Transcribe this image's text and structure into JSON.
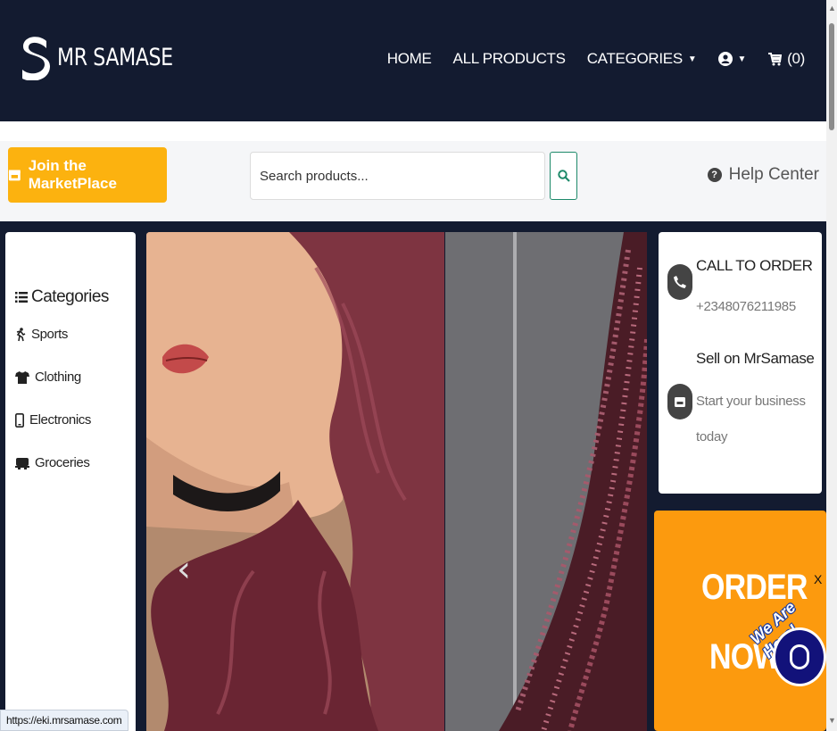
{
  "brand": {
    "name": "MR SAMASE",
    "logo_letter": "S"
  },
  "nav": {
    "home": "HOME",
    "all_products": "ALL PRODUCTS",
    "categories": "CATEGORIES",
    "cart": "(0)"
  },
  "subheader": {
    "join_label": "Join the MarketPlace",
    "search_placeholder": "Search products...",
    "help_label": "Help Center"
  },
  "categories": {
    "title": "Categories",
    "items": [
      {
        "label": "Sports",
        "icon": "running-icon"
      },
      {
        "label": "Clothing",
        "icon": "tshirt-icon"
      },
      {
        "label": "Electronics",
        "icon": "phone-icon"
      },
      {
        "label": "Groceries",
        "icon": "truck-icon"
      }
    ]
  },
  "contact": {
    "call_title": "CALL TO ORDER",
    "phone": "+2348076211985",
    "sell_title": "Sell on MrSamase",
    "sell_sub_1": "Start your business",
    "sell_sub_2": "today"
  },
  "promo": {
    "line1": "ORDER",
    "line2": "NOW",
    "close": "X",
    "chat_badge": "We Are Here!"
  },
  "status_url": "https://eki.mrsamase.com",
  "colors": {
    "navy": "#131b30",
    "accent": "#fcb20f",
    "promo": "#fc9a0e"
  }
}
